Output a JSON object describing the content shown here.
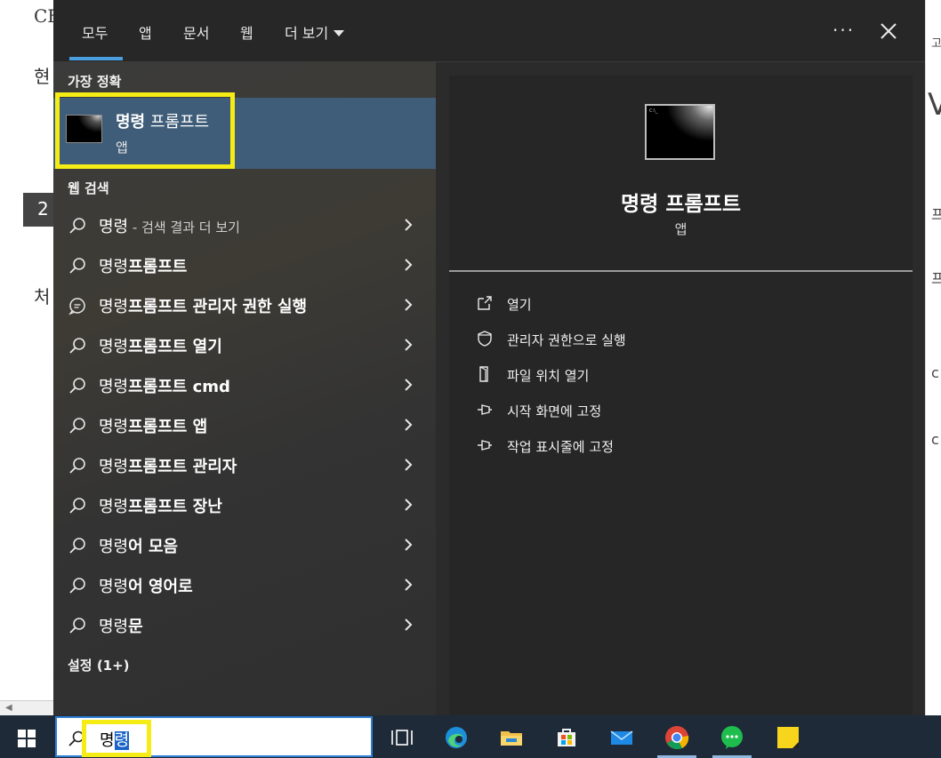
{
  "background": {
    "left_texts": [
      "CF",
      "현",
      "처"
    ],
    "badge": "2",
    "right_fragments": [
      "고",
      "V",
      "프",
      "프",
      "c c",
      "c c"
    ]
  },
  "tabs": {
    "all": "모두",
    "apps": "앱",
    "documents": "문서",
    "web": "웹",
    "more": "더 보기"
  },
  "best_match": {
    "section_label": "가장 정확",
    "title_bold": "명령",
    "title_rest": " 프롬프트",
    "subtitle": "앱"
  },
  "web_search": {
    "section_label": "웹 검색",
    "items": [
      {
        "prefix": "명령",
        "bold": "",
        "muted": " - 검색 결과 더 보기",
        "icon": "search-icon"
      },
      {
        "prefix": "명령",
        "bold": "프롬프트",
        "muted": "",
        "icon": "search-icon"
      },
      {
        "prefix": "명령",
        "bold": "프롬프트 관리자 권한 실행",
        "muted": "",
        "icon": "chat-icon"
      },
      {
        "prefix": "명령",
        "bold": "프롬프트 열기",
        "muted": "",
        "icon": "search-icon"
      },
      {
        "prefix": "명령",
        "bold": "프롬프트 cmd",
        "muted": "",
        "icon": "search-icon"
      },
      {
        "prefix": "명령",
        "bold": "프롬프트 앱",
        "muted": "",
        "icon": "search-icon"
      },
      {
        "prefix": "명령",
        "bold": "프롬프트 관리자",
        "muted": "",
        "icon": "search-icon"
      },
      {
        "prefix": "명령",
        "bold": "프롬프트 장난",
        "muted": "",
        "icon": "search-icon"
      },
      {
        "prefix": "명령",
        "bold": "어 모음",
        "muted": "",
        "icon": "search-icon"
      },
      {
        "prefix": "명령",
        "bold": "어 영어로",
        "muted": "",
        "icon": "search-icon"
      },
      {
        "prefix": "명령",
        "bold": "문",
        "muted": "",
        "icon": "search-icon"
      }
    ]
  },
  "settings": {
    "section_label": "설정 (1+)"
  },
  "preview": {
    "title": "명령 프롬프트",
    "subtitle": "앱",
    "icon_text": "C:\\_",
    "actions": [
      {
        "label": "열기",
        "icon": "open-icon"
      },
      {
        "label": "관리자 권한으로 실행",
        "icon": "shield-icon"
      },
      {
        "label": "파일 위치 열기",
        "icon": "file-location-icon"
      },
      {
        "label": "시작 화면에 고정",
        "icon": "pin-icon"
      },
      {
        "label": "작업 표시줄에 고정",
        "icon": "pin-icon"
      }
    ]
  },
  "taskbar": {
    "search_typed": "명",
    "search_selected": "령",
    "apps": [
      "task-view-icon",
      "edge-icon",
      "file-explorer-icon",
      "store-icon",
      "mail-icon",
      "chrome-icon",
      "messenger-icon",
      "sticky-notes-icon"
    ]
  },
  "colors": {
    "accent": "#4a9fe0",
    "best_match_bg": "#3f5d78",
    "highlight": "#f5ec15",
    "taskbar": "#1e2a38"
  }
}
